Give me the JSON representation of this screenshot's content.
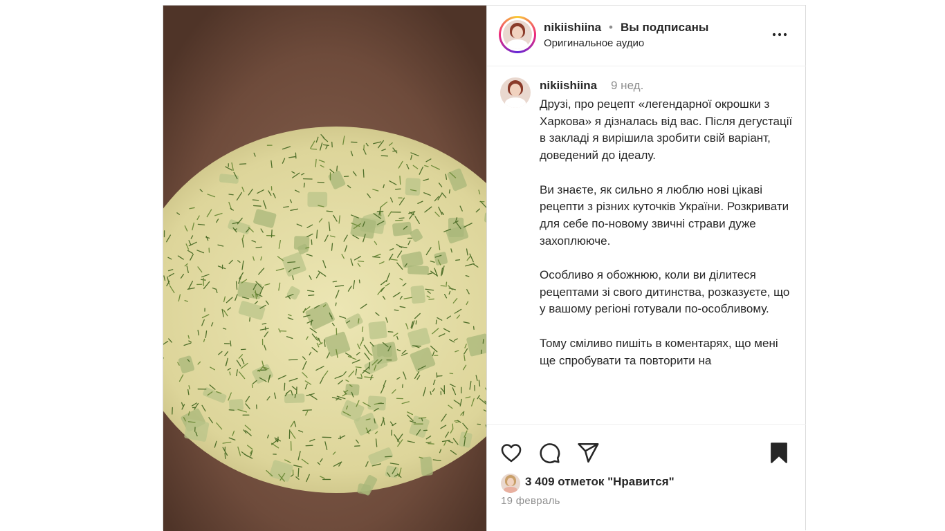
{
  "header": {
    "username": "nikiishiina",
    "separator": "•",
    "follow_status": "Вы подписаны",
    "subtitle": "Оригинальное аудио",
    "more_icon": "more-horizontal-icon"
  },
  "caption": {
    "username": "nikiishiina",
    "time": "9 нед.",
    "text": "Друзі, про рецепт «легендарної окрошки з Харкова» я дізналась від вас. Після дегустації в закладі я вирішила зробити свій варіант, доведений до ідеалу.\n\nВи знаєте, як сильно я люблю нові цікаві рецепти з різних куточків України. Розкривати для себе по-новому звичні страви дуже захоплююче.\n\nОсобливо я обожнюю, коли ви ділитеся рецептами зі свого дитинства, розказуєте, що у вашому регіоні готували по-особливому.\n\nТому сміливо пишіть в коментарях, що мені ще спробувати та повторити на"
  },
  "actions": {
    "icons": [
      "heart-icon",
      "comment-icon",
      "share-icon",
      "bookmark-icon"
    ],
    "likes": "3 409 отметок \"Нравится\"",
    "date": "19 февраль"
  },
  "colors": {
    "text": "#262626",
    "secondary": "#8e8e8e",
    "border": "#dbdbdb",
    "bowl": "#6b4a3c",
    "soup": "#e3dca0",
    "dill": "#4f6f2a"
  }
}
